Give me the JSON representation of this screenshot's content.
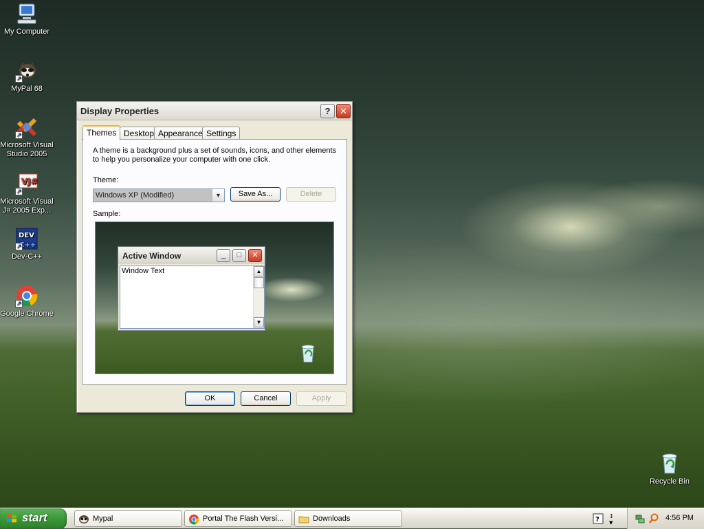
{
  "desktop": {
    "icons": [
      {
        "label": "My Computer"
      },
      {
        "label": "MyPal 68"
      },
      {
        "label": "Microsoft Visual Studio 2005"
      },
      {
        "label": "Microsoft Visual J# 2005 Exp..."
      },
      {
        "label": "Dev-C++"
      },
      {
        "label": "Google Chrome"
      },
      {
        "label": "Recycle Bin"
      }
    ]
  },
  "dialog": {
    "title": "Display Properties",
    "help_label": "?",
    "close_label": "✕",
    "tabs": [
      {
        "label": "Themes"
      },
      {
        "label": "Desktop"
      },
      {
        "label": "Appearance"
      },
      {
        "label": "Settings"
      }
    ],
    "description": "A theme is a background plus a set of sounds, icons, and other elements to help you personalize your computer with one click.",
    "theme_label": "Theme:",
    "theme_value": "Windows XP (Modified)",
    "save_as_label": "Save As...",
    "delete_label": "Delete",
    "sample_label": "Sample:",
    "sample": {
      "window_title": "Active Window",
      "window_text": "Window Text"
    },
    "ok_label": "OK",
    "cancel_label": "Cancel",
    "apply_label": "Apply"
  },
  "taskbar": {
    "start_label": "start",
    "tasks": [
      {
        "label": "Mypal"
      },
      {
        "label": "Portal The Flash Versi..."
      },
      {
        "label": "Downloads"
      }
    ],
    "clock": "4:56 PM"
  }
}
